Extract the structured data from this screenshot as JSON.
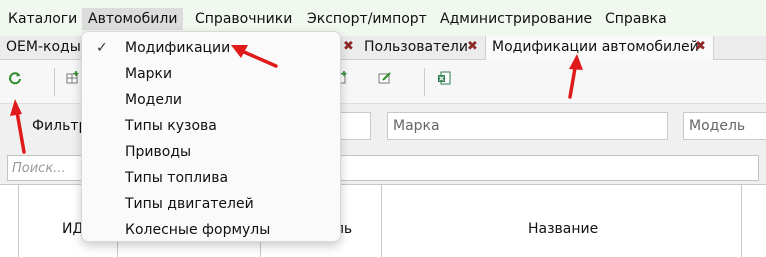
{
  "menubar": {
    "items": [
      {
        "label": "Каталоги"
      },
      {
        "label": "Автомобили"
      },
      {
        "label": "Справочники"
      },
      {
        "label": "Экспорт/импорт"
      },
      {
        "label": "Администрирование"
      },
      {
        "label": "Справка"
      }
    ]
  },
  "tabs": [
    {
      "label": "OEM-коды"
    },
    {
      "label": "Пользователи"
    },
    {
      "label": "Модификации автомобилей"
    }
  ],
  "filters": {
    "label": "Фильтр",
    "brand_placeholder": "Марка",
    "model_placeholder": "Модель"
  },
  "search": {
    "placeholder": "Поиск..."
  },
  "grid": {
    "columns": [
      {
        "label": "ИД"
      },
      {
        "label": "Модель"
      },
      {
        "label": "Название"
      }
    ]
  },
  "dropdown": {
    "items": [
      {
        "label": "Модификации",
        "checked": true
      },
      {
        "label": "Марки"
      },
      {
        "label": "Модели"
      },
      {
        "label": "Типы кузова"
      },
      {
        "label": "Приводы"
      },
      {
        "label": "Типы топлива"
      },
      {
        "label": "Типы двигателей"
      },
      {
        "label": "Колесные формулы"
      }
    ]
  },
  "colors": {
    "menubar_bg": "#f1f8ef",
    "annotation_arrow": "#e01a1a",
    "refresh_icon": "#2e8b2e"
  }
}
